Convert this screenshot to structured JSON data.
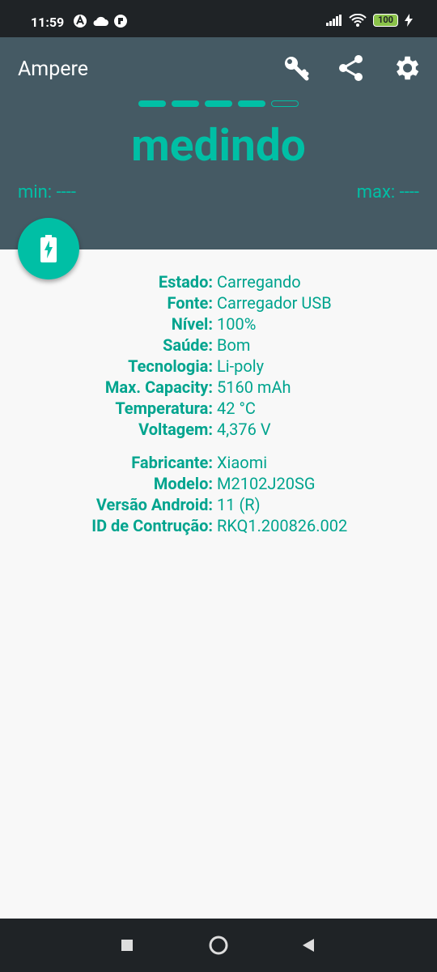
{
  "statusbar": {
    "time": "11:59",
    "battery": "100"
  },
  "appbar": {
    "title": "Ampere",
    "status": "medindo",
    "min": "min: ----",
    "max": "max: ----",
    "progress_filled": 4,
    "progress_total": 5
  },
  "info": [
    {
      "label": "Estado:",
      "value": "Carregando"
    },
    {
      "label": "Fonte:",
      "value": "Carregador USB"
    },
    {
      "label": "Nível:",
      "value": "100%"
    },
    {
      "label": "Saúde:",
      "value": "Bom"
    },
    {
      "label": "Tecnologia:",
      "value": "Li-poly"
    },
    {
      "label": "Max. Capacity:",
      "value": "5160 mAh"
    },
    {
      "label": "Temperatura:",
      "value": "42 °C"
    },
    {
      "label": "Voltagem:",
      "value": "4,376 V"
    }
  ],
  "device": [
    {
      "label": "Fabricante:",
      "value": "Xiaomi"
    },
    {
      "label": "Modelo:",
      "value": "M2102J20SG"
    },
    {
      "label": "Versão Android:",
      "value": "11 (R)"
    },
    {
      "label": "ID de Contrução:",
      "value": "RKQ1.200826.002"
    }
  ],
  "colors": {
    "accent": "#00bfa5",
    "appbar": "#455a64",
    "text": "#00a48e"
  }
}
